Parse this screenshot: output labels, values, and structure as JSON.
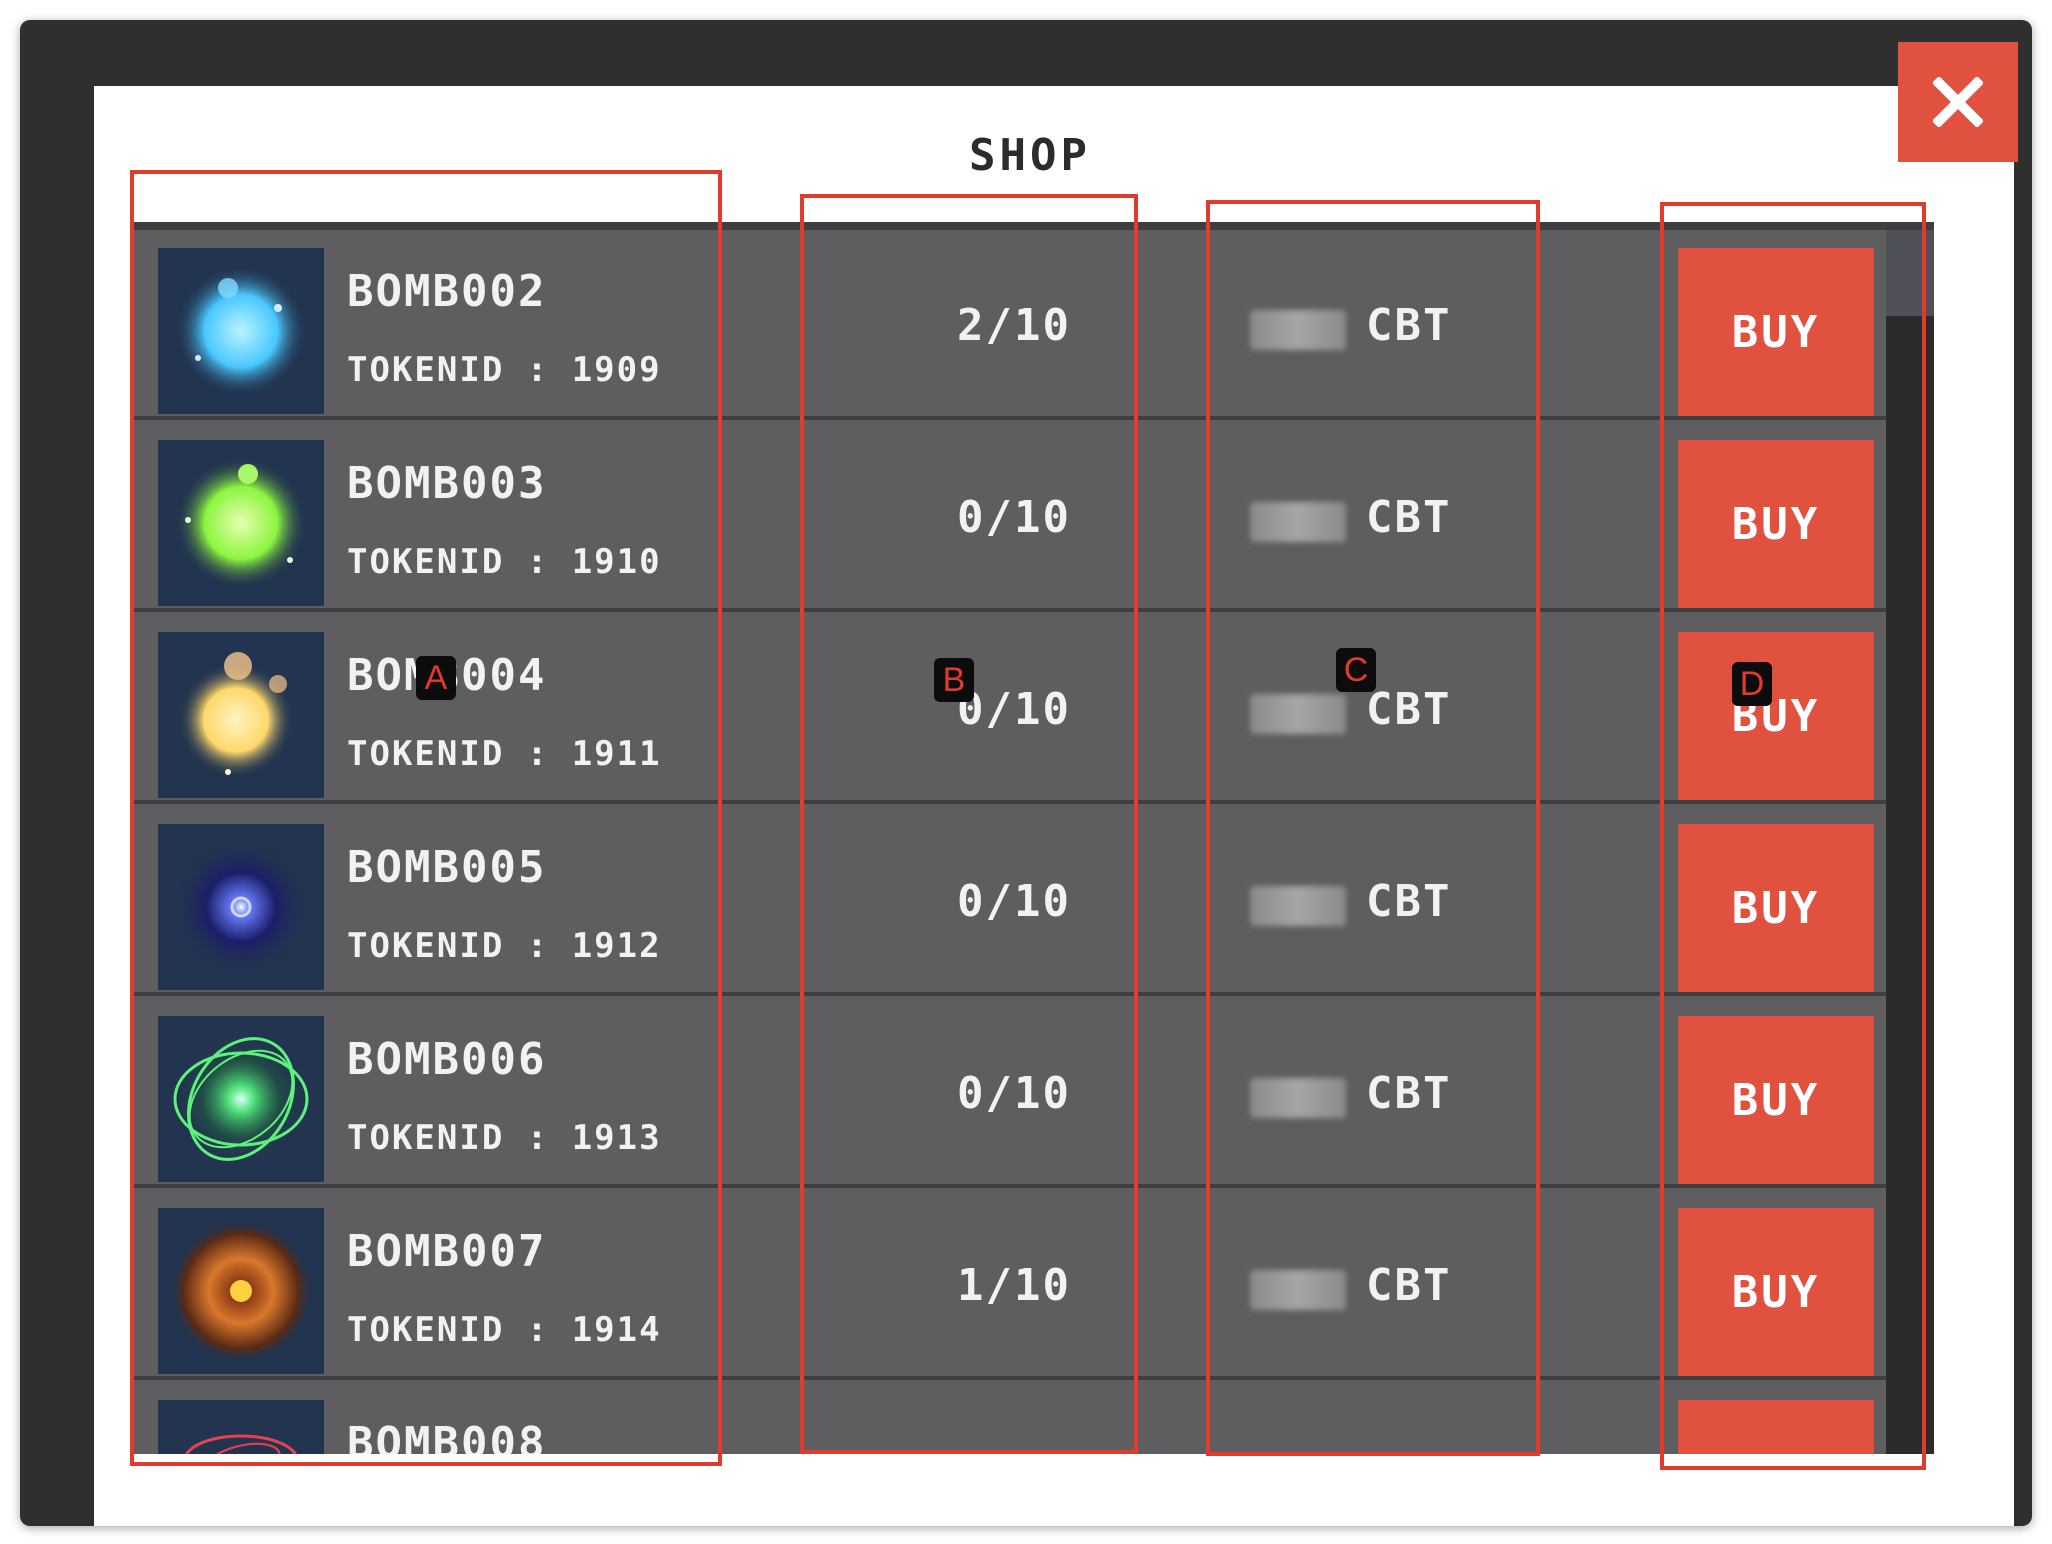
{
  "window": {
    "title": "SHOP",
    "close_label": "✕"
  },
  "items": [
    {
      "name": "BOMB002",
      "token": "TOKENID : 1909",
      "stock": "2/10",
      "currency": "CBT",
      "buy": "BUY",
      "color": "#49c8ff"
    },
    {
      "name": "BOMB003",
      "token": "TOKENID : 1910",
      "stock": "0/10",
      "currency": "CBT",
      "buy": "BUY",
      "color": "#8cf53f"
    },
    {
      "name": "BOMB004",
      "token": "TOKENID : 1911",
      "stock": "0/10",
      "currency": "CBT",
      "buy": "BUY",
      "color": "#ffd86b"
    },
    {
      "name": "BOMB005",
      "token": "TOKENID : 1912",
      "stock": "0/10",
      "currency": "CBT",
      "buy": "BUY",
      "color": "#3b3fbf"
    },
    {
      "name": "BOMB006",
      "token": "TOKENID : 1913",
      "stock": "0/10",
      "currency": "CBT",
      "buy": "BUY",
      "color": "#4fe07a"
    },
    {
      "name": "BOMB007",
      "token": "TOKENID : 1914",
      "stock": "1/10",
      "currency": "CBT",
      "buy": "BUY",
      "color": "#d9772c"
    },
    {
      "name": "BOMB008",
      "token": "",
      "stock": "",
      "currency": "",
      "buy": "",
      "color": "#e8424f"
    }
  ],
  "annotations": {
    "a": "A",
    "b": "B",
    "c": "C",
    "d": "D"
  },
  "colors": {
    "accent": "#e05140",
    "list_bg": "#5e5e60",
    "highlight": "#e23b2e"
  }
}
